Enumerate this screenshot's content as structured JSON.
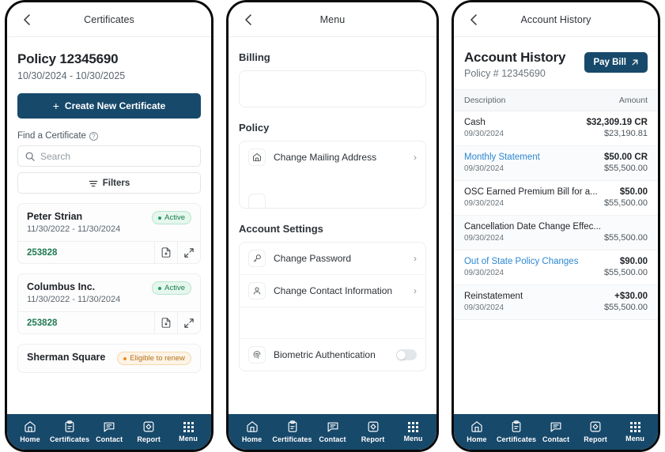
{
  "bottom_nav": {
    "items": [
      {
        "label": "Home",
        "icon": "home-icon"
      },
      {
        "label": "Certificates",
        "icon": "clipboard-icon"
      },
      {
        "label": "Contact",
        "icon": "chat-icon"
      },
      {
        "label": "Report",
        "icon": "report-shield-icon"
      },
      {
        "label": "Menu",
        "icon": "grid-dots-icon"
      }
    ]
  },
  "colors": {
    "navy": "#17496b",
    "green_link": "#1f7a52",
    "blue_link": "#2b87d1",
    "badge_active_text": "#177a4c",
    "badge_renew_text": "#b5711a"
  },
  "screen_certificates": {
    "topbar_title": "Certificates",
    "back_icon": "chevron-left-icon",
    "policy_title": "Policy 12345690",
    "policy_dates": "10/30/2024 - 10/30/2025",
    "create_button": "Create New Certificate",
    "find_label": "Find a Certificate",
    "help_icon": "question-mark-icon",
    "search_placeholder": "Search",
    "search_value": "",
    "filters_label": "Filters",
    "certificates": [
      {
        "name": "Peter Strian",
        "dates": "11/30/2022 - 11/30/2024",
        "status": "Active",
        "status_type": "active",
        "number": "253828"
      },
      {
        "name": "Columbus Inc.",
        "dates": "11/30/2022 - 11/30/2024",
        "status": "Active",
        "status_type": "active",
        "number": "253828"
      },
      {
        "name": "Sherman Square",
        "dates": "",
        "status": "Eligible to renew",
        "status_type": "renew",
        "number": ""
      }
    ]
  },
  "screen_menu": {
    "topbar_title": "Menu",
    "back_icon": "chevron-left-icon",
    "sections": [
      {
        "title": "Billing",
        "items": []
      },
      {
        "title": "Policy",
        "items": [
          {
            "label": "Change Mailing Address",
            "icon": "home-icon",
            "chevron": "›"
          }
        ]
      },
      {
        "title": "Account Settings",
        "items": [
          {
            "label": "Change Password",
            "icon": "key-icon",
            "chevron": "›"
          },
          {
            "label": "Change Contact Information",
            "icon": "person-icon",
            "chevron": "›"
          },
          {
            "label": "Biometric Authentication",
            "icon": "fingerprint-icon",
            "toggle": "off"
          }
        ]
      }
    ]
  },
  "screen_account_history": {
    "topbar_title": "Account History",
    "back_icon": "chevron-left-icon",
    "title": "Account History",
    "subtitle": "Policy # 12345690",
    "pay_bill_label": "Pay Bill",
    "pay_bill_icon": "arrow-up-right-icon",
    "table_headers": {
      "description": "Description",
      "amount": "Amount"
    },
    "transactions": [
      {
        "description": "Cash",
        "is_link": false,
        "date": "09/30/2024",
        "amount": "$32,309.19 CR",
        "balance": "$23,190.81"
      },
      {
        "description": "Monthly Statement",
        "is_link": true,
        "date": "09/30/2024",
        "amount": "$50.00 CR",
        "balance": "$55,500.00"
      },
      {
        "description": "OSC Earned Premium Bill for a...",
        "is_link": false,
        "date": "09/30/2024",
        "amount": "$50.00",
        "balance": "$55,500.00"
      },
      {
        "description": "Cancellation Date Change Effec...",
        "is_link": false,
        "date": "09/30/2024",
        "amount": "",
        "balance": "$55,500.00"
      },
      {
        "description": "Out of State Policy Changes",
        "is_link": true,
        "date": "09/30/2024",
        "amount": "$90.00",
        "balance": "$55,500.00"
      },
      {
        "description": "Reinstatement",
        "is_link": false,
        "date": "09/30/2024",
        "amount": "+$30.00",
        "balance": "$55,500.00"
      }
    ]
  }
}
